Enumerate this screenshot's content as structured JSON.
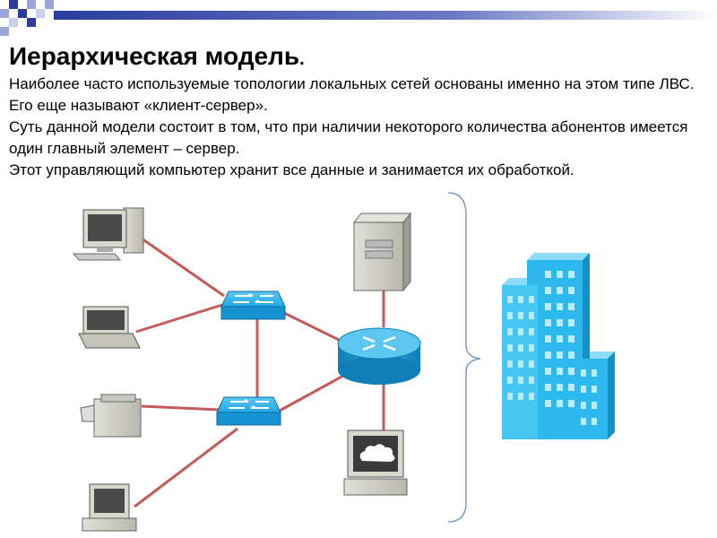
{
  "slide": {
    "title": "Иерархическая модель",
    "title_suffix": ".",
    "paragraphs": [
      " Наиболее часто используемые топологии локальных сетей основаны именно на этом типе ЛВС. Его еще называют «клиент-сервер».",
      "Суть данной модели состоит в том, что при наличии некоторого количества абонентов имеется один главный элемент – сервер.",
      " Этот управляющий компьютер хранит все данные и занимается их обработкой."
    ]
  },
  "colors": {
    "link": "#c65a5a",
    "device_blue": "#1ea7e3",
    "device_blue_dark": "#0f7fb6",
    "building_blue": "#2db8ee",
    "deco_blue": "#2a3d9e",
    "brace": "#7a9ac8"
  },
  "icons": [
    "desktop-pc-icon",
    "laptop-icon",
    "printer-icon",
    "terminal-pc-icon",
    "switch-icon",
    "router-icon",
    "server-icon",
    "workstation-icon",
    "building-icon",
    "brace-icon"
  ]
}
